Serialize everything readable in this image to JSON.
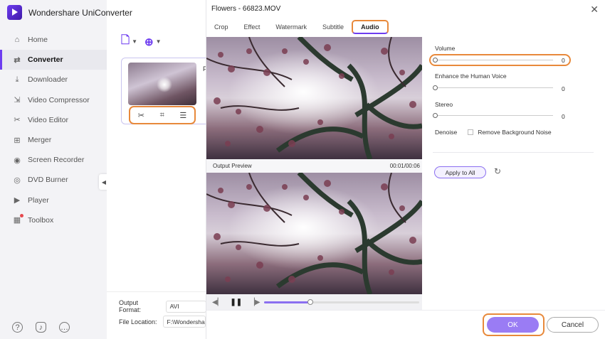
{
  "app": {
    "title": "Wondershare UniConverter"
  },
  "sidebar": {
    "items": [
      {
        "label": "Home",
        "icon": "home-icon",
        "active": false
      },
      {
        "label": "Converter",
        "icon": "converter-icon",
        "active": true
      },
      {
        "label": "Downloader",
        "icon": "downloader-icon",
        "active": false
      },
      {
        "label": "Video Compressor",
        "icon": "compressor-icon",
        "active": false
      },
      {
        "label": "Video Editor",
        "icon": "scissors-icon",
        "active": false
      },
      {
        "label": "Merger",
        "icon": "merger-icon",
        "active": false
      },
      {
        "label": "Screen Recorder",
        "icon": "recorder-icon",
        "active": false
      },
      {
        "label": "DVD Burner",
        "icon": "disc-icon",
        "active": false
      },
      {
        "label": "Player",
        "icon": "play-icon",
        "active": false
      },
      {
        "label": "Toolbox",
        "icon": "grid-icon",
        "active": false
      }
    ],
    "bottom_icons": [
      "help-icon",
      "bell-icon",
      "feedback-icon"
    ]
  },
  "main": {
    "card_title": "F",
    "output_format_label": "Output Format:",
    "output_format_value": "AVI",
    "file_location_label": "File Location:",
    "file_location_value": "F:\\Wondershare"
  },
  "modal": {
    "title": "Flowers - 66823.MOV",
    "tabs": [
      "Crop",
      "Effect",
      "Watermark",
      "Subtitle",
      "Audio"
    ],
    "active_tab": "Audio",
    "output_preview_label": "Output Preview",
    "time": "00:01/00:06",
    "playback_progress": 0.3,
    "audio": {
      "volume_label": "Volume",
      "volume_value": "0",
      "enhance_label": "Enhance the Human Voice",
      "enhance_value": "0",
      "stereo_label": "Stereo",
      "stereo_value": "0",
      "denoise_label": "Denoise",
      "remove_noise_label": "Remove Background Noise",
      "remove_noise_checked": false
    },
    "apply_all_label": "Apply to All",
    "ok_label": "OK",
    "cancel_label": "Cancel"
  },
  "colors": {
    "accent": "#6d3cf0",
    "highlight": "#e8893b",
    "ok_button": "#9a7cf4"
  }
}
